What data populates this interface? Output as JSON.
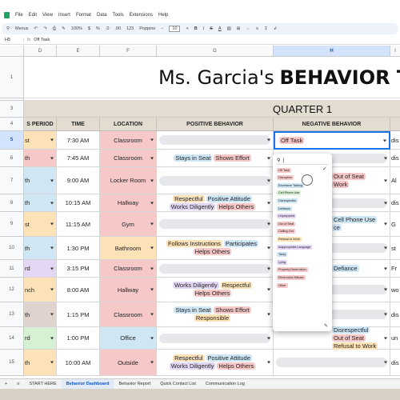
{
  "menu": {
    "items": [
      "File",
      "Edit",
      "View",
      "Insert",
      "Format",
      "Data",
      "Tools",
      "Extensions",
      "Help"
    ]
  },
  "toolbar": {
    "search": "Menus",
    "zoom": "100%",
    "currency": "$",
    "percent": "%",
    "decimals": ".0",
    "decimals2": ".00",
    "number_format": "123",
    "font": "Poppins",
    "font_size": "10"
  },
  "formula": {
    "cell_ref": "H5",
    "value": "Off Task"
  },
  "columns": [
    "D",
    "E",
    "F",
    "G",
    "H"
  ],
  "col_partial": "I",
  "rows": [
    "1",
    "3",
    "4",
    "5",
    "6",
    "7",
    "8",
    "9",
    "10",
    "11",
    "12",
    "13",
    "14",
    "15"
  ],
  "title": {
    "name": "Ms. Garcia's",
    "main": "BEHAVIOR TRACKE"
  },
  "quarter": "QUARTER 1",
  "headers": {
    "period": "S PERIOD",
    "time": "TIME",
    "location": "LOCATION",
    "positive": "POSITIVE BEHAVIOR",
    "negative": "NEGATIVE BEHAVIOR"
  },
  "table_rows": [
    {
      "period": "st",
      "time": "7:30 AM",
      "location": "Classroom",
      "positive": [],
      "negative": [
        {
          "text": "Off Task",
          "color": "#f7c8c8"
        }
      ],
      "extra": "dis"
    },
    {
      "period": "th",
      "time": "7:45 AM",
      "location": "Classroom",
      "positive": [
        {
          "text": "Stays in Seat",
          "color": "#cfe6f5"
        },
        {
          "text": "Shows Effort",
          "color": "#f7c8c8"
        }
      ],
      "negative": [],
      "extra": "dis"
    },
    {
      "period": "th",
      "time": "9:00 AM",
      "location": "Locker Room",
      "positive": [],
      "negative": [
        {
          "text": "Out of Seat",
          "color": "#f7c8c8"
        },
        {
          "text": "Work",
          "color": "#f7c8c8"
        }
      ],
      "extra": "Al"
    },
    {
      "period": "th",
      "time": "10:15 AM",
      "location": "Hallway",
      "positive": [
        {
          "text": "Respectful",
          "color": "#fde2b8"
        },
        {
          "text": "Positive Attitude",
          "color": "#cfe6f5"
        },
        {
          "text": "Works Diligently",
          "color": "#e4d7f5"
        },
        {
          "text": "Helps Others",
          "color": "#f7c8c8"
        }
      ],
      "negative": [],
      "extra": "dis"
    },
    {
      "period": "st",
      "time": "11:15 AM",
      "location": "Gym",
      "positive": [],
      "negative": [
        {
          "text": "Cell Phone Use",
          "color": "#cfe6f5"
        },
        {
          "text": "ce",
          "color": "#cfe6f5"
        }
      ],
      "extra": "G"
    },
    {
      "period": "th",
      "time": "1:30 PM",
      "location": "Bathroom",
      "positive": [
        {
          "text": "Follows Instructions",
          "color": "#fde2b8"
        },
        {
          "text": "Participates",
          "color": "#cfe6f5"
        },
        {
          "text": "Helps Others",
          "color": "#f7c8c8"
        }
      ],
      "negative": [],
      "extra": "st"
    },
    {
      "period": "rd",
      "time": "3:15 PM",
      "location": "Classroom",
      "positive": [],
      "negative": [
        {
          "text": "Defiance",
          "color": "#cfe6f5"
        }
      ],
      "extra": "Fr"
    },
    {
      "period": "nch",
      "time": "8:00 AM",
      "location": "Hallway",
      "positive": [
        {
          "text": "Works Diligently",
          "color": "#e4d7f5"
        },
        {
          "text": "Respectful",
          "color": "#fde2b8"
        },
        {
          "text": "Helps Others",
          "color": "#f7c8c8"
        }
      ],
      "negative": [],
      "extra": "wo"
    },
    {
      "period": "th",
      "time": "1:15 PM",
      "location": "Classroom",
      "positive": [
        {
          "text": "Stays in Seat",
          "color": "#cfe6f5"
        },
        {
          "text": "Shows Effort",
          "color": "#f7c8c8"
        },
        {
          "text": "Responsible",
          "color": "#fde2b8"
        }
      ],
      "negative": [],
      "extra": "dis"
    },
    {
      "period": "rd",
      "time": "1:00 PM",
      "location": "Office",
      "positive": [],
      "negative": [
        {
          "text": "Disrespectful",
          "color": "#cfe6f5"
        },
        {
          "text": "Out of Seat",
          "color": "#f7c8c8"
        },
        {
          "text": "Refusal to Work",
          "color": "#fde2b8"
        }
      ],
      "extra": "un"
    },
    {
      "period": "th",
      "time": "10:00 AM",
      "location": "Outside",
      "positive": [
        {
          "text": "Respectful",
          "color": "#fde2b8"
        },
        {
          "text": "Positive Attitude",
          "color": "#cfe6f5"
        },
        {
          "text": "Works Diligently",
          "color": "#e4d7f5"
        },
        {
          "text": "Helps Others",
          "color": "#f7c8c8"
        }
      ],
      "negative": [],
      "extra": "dis"
    }
  ],
  "location_colors": {
    "Classroom": "#f7c8c8",
    "Locker Room": "#f7c8c8",
    "Hallway": "#f7c8c8",
    "Gym": "#f7c8c8",
    "Bathroom": "#fde2b8",
    "Office": "#cfe6f5",
    "Outside": "#f7c8c8"
  },
  "period_colors": [
    "#fde2b8",
    "#f7c8c8",
    "#cfe6f5",
    "#cfe6f5",
    "#fde2b8",
    "#cfe6f5",
    "#e4d7f5",
    "#fde2b8",
    "#e0d3cd",
    "#d5f0d2",
    "#fde2b8"
  ],
  "dropdown": {
    "search": "|",
    "options": [
      {
        "text": "Off Task",
        "color": "#f7c8c8"
      },
      {
        "text": "Disruptive",
        "color": "#f7c8c8"
      },
      {
        "text": "Excessive Talking",
        "color": "#cfe6f5"
      },
      {
        "text": "Cell Phone Use",
        "color": "#d5f0d2"
      },
      {
        "text": "Disrespectful",
        "color": "#cfe6f5"
      },
      {
        "text": "Defiance",
        "color": "#cfe6f5"
      },
      {
        "text": "Unprepared",
        "color": "#e4d7f5"
      },
      {
        "text": "Out of Seat",
        "color": "#f7c8c8"
      },
      {
        "text": "Calling Out",
        "color": "#f7c8c8"
      },
      {
        "text": "Refusal to Work",
        "color": "#fde2b8"
      },
      {
        "text": "Inappropriate Language",
        "color": "#e4d7f5"
      },
      {
        "text": "Tardy",
        "color": "#cfe6f5"
      },
      {
        "text": "Lying",
        "color": "#e4d7f5"
      },
      {
        "text": "Property Destruction",
        "color": "#f7c8c8"
      },
      {
        "text": "Electronics Misuse",
        "color": "#f7c8c8"
      },
      {
        "text": "Other",
        "color": "#f7c8c8"
      }
    ]
  },
  "sheets": {
    "add": "+",
    "list": "≡",
    "tabs": [
      "START HERE",
      "Behavior Dashboard",
      "Behavior Report",
      "Quick Contact List",
      "Communication Log"
    ],
    "active": 1
  },
  "colors": {
    "accent": "#1a73e8",
    "header_bg": "#e3dcd0"
  }
}
